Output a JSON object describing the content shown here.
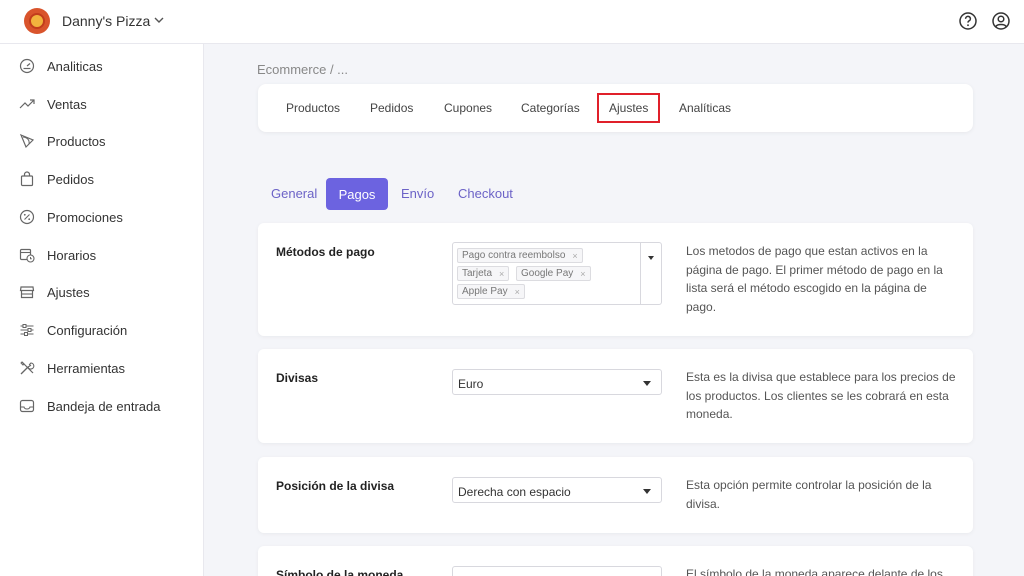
{
  "header": {
    "brand": "Danny's Pizza",
    "icons": [
      "pizza-logo-icon",
      "chevron-down-icon",
      "help-icon",
      "user-icon"
    ]
  },
  "sidebar": {
    "items": [
      {
        "label": "Analiticas",
        "icon": "gauge-icon"
      },
      {
        "label": "Ventas",
        "icon": "trend-icon"
      },
      {
        "label": "Productos",
        "icon": "pizza-slice-icon"
      },
      {
        "label": "Pedidos",
        "icon": "bag-icon"
      },
      {
        "label": "Promociones",
        "icon": "percent-icon"
      },
      {
        "label": "Horarios",
        "icon": "calendar-clock-icon"
      },
      {
        "label": "Ajustes",
        "icon": "store-icon"
      },
      {
        "label": "Configuración",
        "icon": "sliders-icon"
      },
      {
        "label": "Herramientas",
        "icon": "tools-icon"
      },
      {
        "label": "Bandeja de entrada",
        "icon": "inbox-icon"
      }
    ]
  },
  "breadcrumb": "Ecommerce  /  ...",
  "tabs": [
    "Productos",
    "Pedidos",
    "Cupones",
    "Categorías",
    "Ajustes",
    "Analíticas"
  ],
  "active_tab": "Ajustes",
  "subtabs": [
    "General",
    "Pagos",
    "Envío",
    "Checkout"
  ],
  "active_subtab": "Pagos",
  "settings": {
    "payment": {
      "label": "Métodos de pago",
      "chips": [
        "Pago contra reembolso",
        "Tarjeta",
        "Google Pay",
        "Apple Pay"
      ],
      "chip_remove": "×",
      "description": "Los metodos de pago que estan activos en la página de pago. El primer método de pago en la lista será el método escogido en la página de pago."
    },
    "currency": {
      "label": "Divisas",
      "value": "Euro",
      "description": "Esta es la divisa que establece para los precios de los productos. Los clientes se les cobrará en esta moneda."
    },
    "currency_position": {
      "label": "Posición de la divisa",
      "value": "Derecha con espacio",
      "description": "Esta opción permite controlar la posición de la divisa."
    },
    "currency_symbol": {
      "label": "Símbolo de la moneda",
      "value": "€",
      "description": "El símbolo de la moneda aparece delante de los"
    }
  },
  "colors": {
    "accent": "#6c63e0",
    "highlight": "#e0202a",
    "logo": "#d9542c"
  }
}
